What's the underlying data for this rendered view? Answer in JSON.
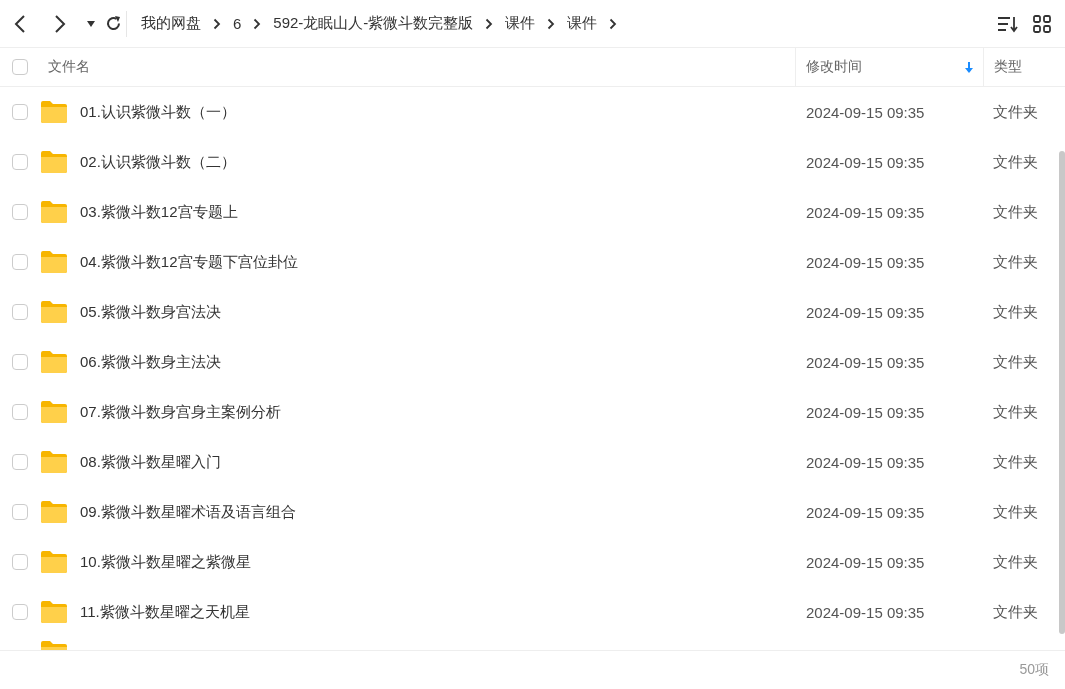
{
  "toolbar": {
    "breadcrumbs": [
      "我的网盘",
      "6",
      "592-龙眠山人-紫微斗数完整版",
      "课件",
      "课件"
    ]
  },
  "table": {
    "select_all": {
      "checked": false
    },
    "columns": [
      {
        "label": "文件名",
        "sorted": false
      },
      {
        "label": "修改时间",
        "sorted": true
      },
      {
        "label": "类型",
        "sorted": false
      }
    ],
    "rows": [
      {
        "name": "01.认识紫微斗数（一）",
        "modified": "2024-09-15 09:35",
        "type": "文件夹",
        "checked": false
      },
      {
        "name": "02.认识紫微斗数（二）",
        "modified": "2024-09-15 09:35",
        "type": "文件夹",
        "checked": false
      },
      {
        "name": "03.紫微斗数12宫专题上",
        "modified": "2024-09-15 09:35",
        "type": "文件夹",
        "checked": false
      },
      {
        "name": "04.紫微斗数12宫专题下宫位卦位",
        "modified": "2024-09-15 09:35",
        "type": "文件夹",
        "checked": false
      },
      {
        "name": "05.紫微斗数身宫法决",
        "modified": "2024-09-15 09:35",
        "type": "文件夹",
        "checked": false
      },
      {
        "name": "06.紫微斗数身主法决",
        "modified": "2024-09-15 09:35",
        "type": "文件夹",
        "checked": false
      },
      {
        "name": "07.紫微斗数身宫身主案例分析",
        "modified": "2024-09-15 09:35",
        "type": "文件夹",
        "checked": false
      },
      {
        "name": "08.紫微斗数星曜入门",
        "modified": "2024-09-15 09:35",
        "type": "文件夹",
        "checked": false
      },
      {
        "name": "09.紫微斗数星曜术语及语言组合",
        "modified": "2024-09-15 09:35",
        "type": "文件夹",
        "checked": false
      },
      {
        "name": "10.紫微斗数星曜之紫微星",
        "modified": "2024-09-15 09:35",
        "type": "文件夹",
        "checked": false
      },
      {
        "name": "11.紫微斗数星曜之天机星",
        "modified": "2024-09-15 09:35",
        "type": "文件夹",
        "checked": false
      }
    ]
  },
  "status_bar": {
    "count": "50项"
  }
}
